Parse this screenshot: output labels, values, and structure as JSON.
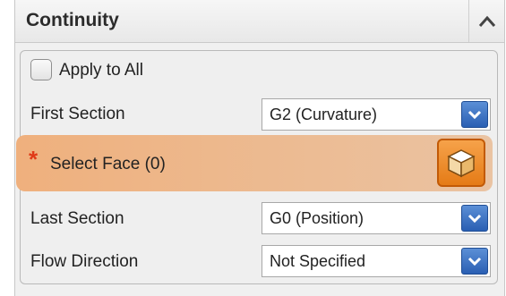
{
  "panel": {
    "title": "Continuity"
  },
  "apply_to_all": {
    "label": "Apply to All",
    "checked": false
  },
  "first_section": {
    "label": "First Section",
    "value": "G2 (Curvature)"
  },
  "select_face": {
    "marker": "*",
    "label": "Select Face (0)"
  },
  "last_section": {
    "label": "Last Section",
    "value": "G0 (Position)"
  },
  "flow_direction": {
    "label": "Flow Direction",
    "value": "Not Specified"
  },
  "colors": {
    "accent_blue": "#2a5fb3",
    "select_bar_orange": "#efb07d",
    "asterisk_red": "#e03a17",
    "face_button_orange": "#e57b16"
  },
  "icons": {
    "collapse": "chevron-up-icon",
    "dropdown": "dropdown-arrow-icon",
    "face_select": "cube-icon"
  }
}
